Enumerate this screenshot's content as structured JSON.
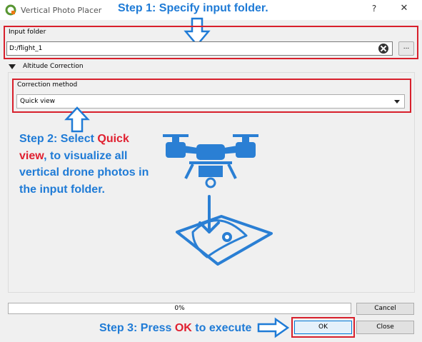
{
  "window": {
    "title": "Vertical Photo Placer",
    "help_label": "?",
    "close_label": "✕"
  },
  "annotations": {
    "step1": "Step 1: Specify input folder.",
    "step2_prefix": "Step 2: Select ",
    "step2_highlight": "Quick view",
    "step2_suffix": ", to visualize all vertical drone photos in the input folder.",
    "step3_prefix": "Step 3: Press ",
    "step3_highlight": "OK",
    "step3_suffix": " to execute"
  },
  "input_folder": {
    "label": "Input folder",
    "value": "D:/flight_1",
    "browse_label": "..."
  },
  "altitude_correction": {
    "title": "Altitude Correction",
    "method_label": "Correction method",
    "method_value": "Quick view"
  },
  "footer": {
    "progress_percent": 0,
    "progress_text": "0%",
    "cancel_label": "Cancel",
    "ok_label": "OK",
    "close_label": "Close"
  },
  "colors": {
    "annotation_blue": "#1f7bd6",
    "highlight_red": "#e02030",
    "box_red": "#d8202c",
    "drone_blue": "#2a7fd4"
  }
}
